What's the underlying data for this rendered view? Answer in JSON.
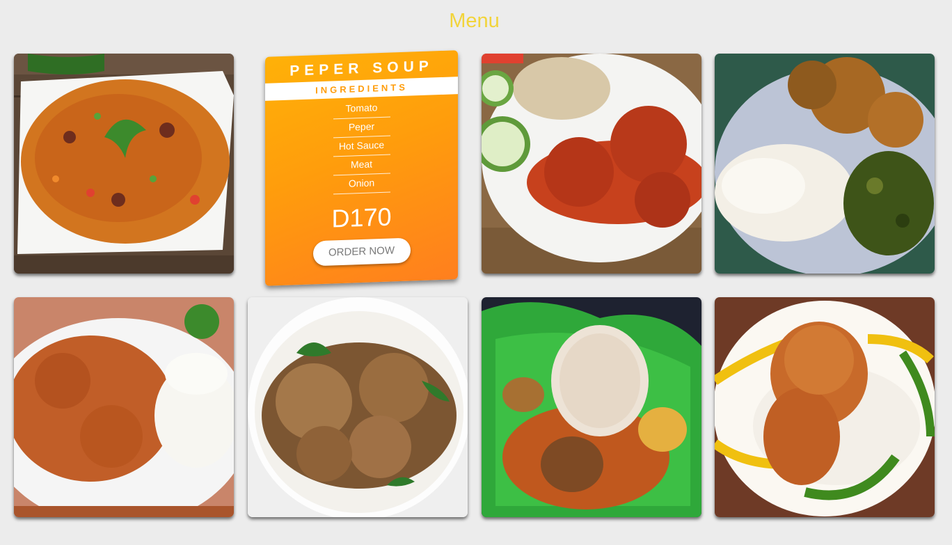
{
  "header": {
    "title": "Menu"
  },
  "featured": {
    "title": "PEPER SOUP",
    "ingredients_label": "INGREDIENTS",
    "ingredients": [
      "Tomato",
      "Peper",
      "Hot Sauce",
      "Meat",
      "Onion"
    ],
    "price": "D170",
    "order_label": "ORDER NOW"
  },
  "colors": {
    "background": "#ececec",
    "title": "#f2d43a",
    "card_orange": "#ff9d0c"
  }
}
